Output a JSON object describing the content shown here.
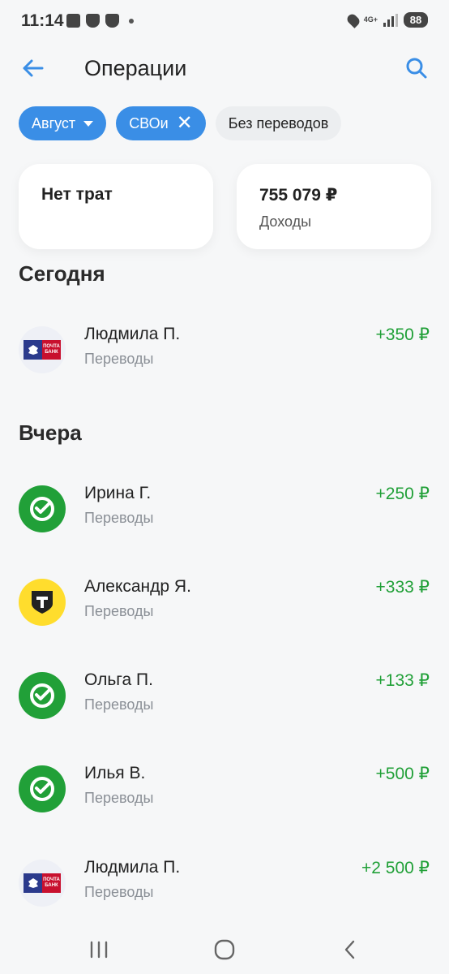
{
  "status_bar": {
    "time": "11:14",
    "network": "4G+",
    "battery": "88"
  },
  "header": {
    "title": "Операции"
  },
  "filters": [
    {
      "label": "Август",
      "active": true
    },
    {
      "label": "СВОи",
      "active": true
    },
    {
      "label": "Без переводов",
      "active": false
    }
  ],
  "summary": {
    "spending": {
      "value": "Нет трат"
    },
    "income": {
      "value": "755 079 ₽",
      "label": "Доходы"
    }
  },
  "sections": {
    "today": "Сегодня",
    "yesterday": "Вчера"
  },
  "operations": [
    {
      "name": "Людмила П.",
      "category": "Переводы",
      "amount": "+350 ₽",
      "bank": "pochta-bank"
    },
    {
      "name": "Ирина Г.",
      "category": "Переводы",
      "amount": "+250 ₽",
      "bank": "sber"
    },
    {
      "name": "Александр Я.",
      "category": "Переводы",
      "amount": "+333 ₽",
      "bank": "t-bank"
    },
    {
      "name": "Ольга П.",
      "category": "Переводы",
      "amount": "+133 ₽",
      "bank": "sber"
    },
    {
      "name": "Илья В.",
      "category": "Переводы",
      "amount": "+500 ₽",
      "bank": "sber"
    },
    {
      "name": "Людмила П.",
      "category": "Переводы",
      "amount": "+2 500 ₽",
      "bank": "pochta-bank"
    }
  ],
  "pochta_logo_text": "ПОЧТА БАНК",
  "colors": {
    "accent": "#3a8ee6",
    "income": "#21a038",
    "sber": "#21a038",
    "tbank": "#ffdd2d",
    "pochta_blue": "#2b3a8c",
    "pochta_red": "#c8102e"
  }
}
